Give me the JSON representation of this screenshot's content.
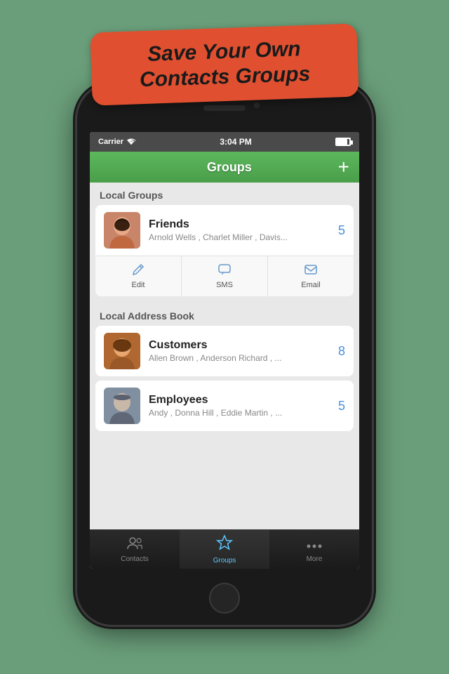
{
  "promo": {
    "text": "Save Your Own Contacts Groups"
  },
  "status_bar": {
    "carrier": "Carrier",
    "time": "3:04 PM"
  },
  "nav": {
    "title": "Groups",
    "add_button": "+"
  },
  "sections": [
    {
      "id": "local-groups",
      "header": "Local Groups",
      "items": [
        {
          "id": "friends",
          "name": "Friends",
          "members": "Arnold Wells , Charlet Miller , Davis...",
          "count": "5",
          "avatar_type": "woman1",
          "expanded": true,
          "actions": [
            {
              "id": "edit",
              "label": "Edit",
              "icon": "✏️"
            },
            {
              "id": "sms",
              "label": "SMS",
              "icon": "💬"
            },
            {
              "id": "email",
              "label": "Email",
              "icon": "✉️"
            }
          ]
        }
      ]
    },
    {
      "id": "local-address-book",
      "header": "Local Address Book",
      "items": [
        {
          "id": "customers",
          "name": "Customers",
          "members": "Allen Brown , Anderson Richard , ...",
          "count": "8",
          "avatar_type": "woman2",
          "expanded": false
        },
        {
          "id": "employees",
          "name": "Employees",
          "members": "Andy , Donna Hill , Eddie Martin , ...",
          "count": "5",
          "avatar_type": "man1",
          "expanded": false
        }
      ]
    }
  ],
  "tab_bar": {
    "tabs": [
      {
        "id": "contacts",
        "label": "Contacts",
        "active": false
      },
      {
        "id": "groups",
        "label": "Groups",
        "active": true
      },
      {
        "id": "more",
        "label": "More",
        "active": false
      }
    ]
  }
}
